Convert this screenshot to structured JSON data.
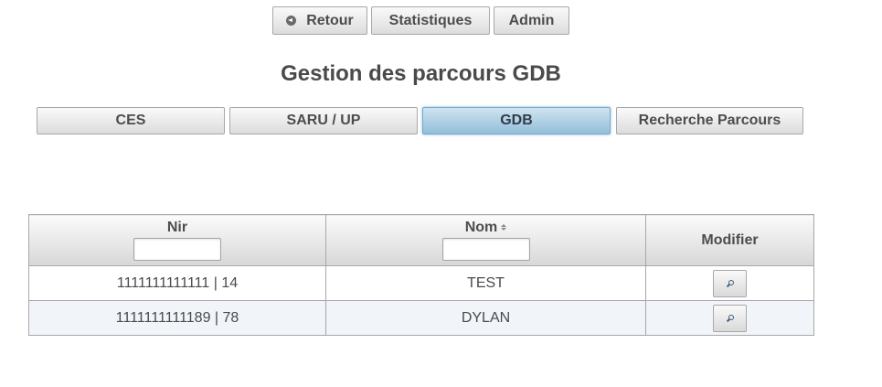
{
  "nav": {
    "retour": "Retour",
    "statistiques": "Statistiques",
    "admin": "Admin"
  },
  "page_title": "Gestion des parcours GDB",
  "tabs": [
    "CES",
    "SARU / UP",
    "GDB",
    "Recherche Parcours"
  ],
  "active_tab": "GDB",
  "table": {
    "columns": [
      "Nir",
      "Nom",
      "Modifier"
    ],
    "rows": [
      {
        "nir": "1111111111111 | 14",
        "nom": "TEST"
      },
      {
        "nir": "1111111111189 | 78",
        "nom": "DYLAN"
      }
    ]
  },
  "icons": {
    "retour": "circle-arrow-left-icon",
    "sort": "sort-icon",
    "modifier": "magnifier-icon"
  },
  "colors": {
    "active_tab_bg": "#93bfd9",
    "alt_row_bg": "#f1f4f8"
  }
}
